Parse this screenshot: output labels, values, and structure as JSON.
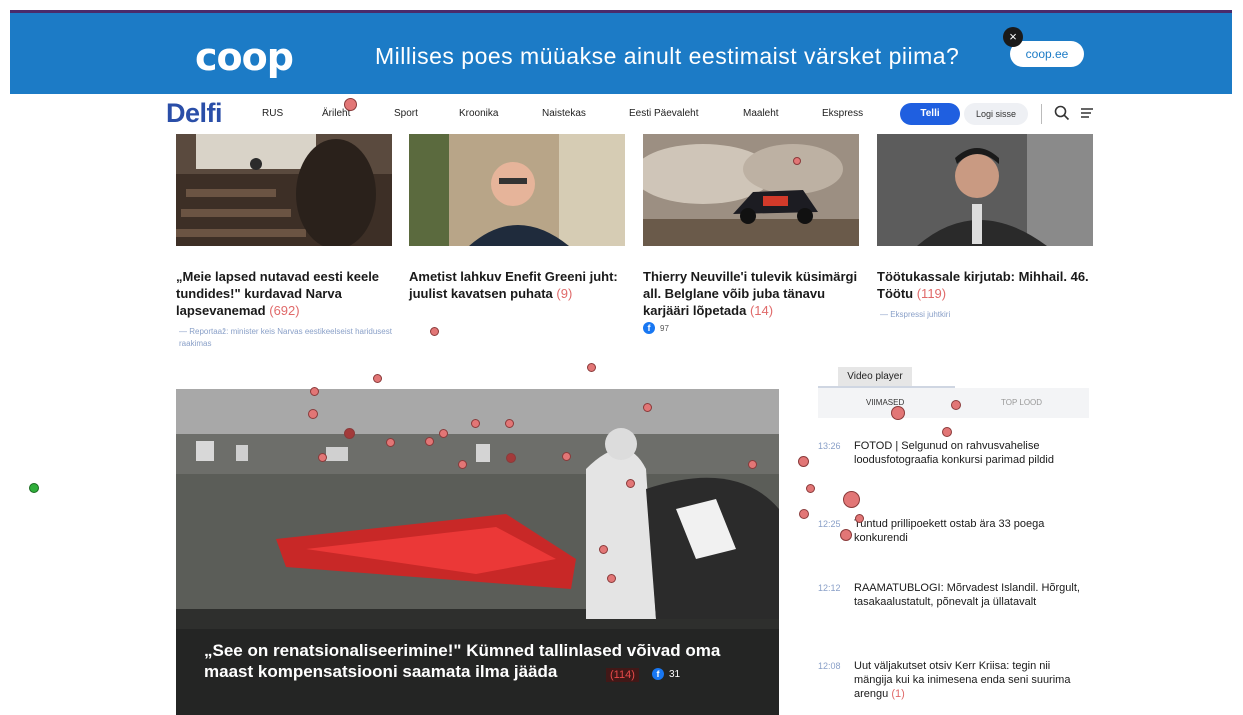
{
  "ad": {
    "logo": "coop",
    "text": "Millises poes müüakse ainult eestimaist värsket piima?",
    "button": "coop.ee",
    "close": "×",
    "colors": {
      "background": "#1c7bc6"
    }
  },
  "nav": {
    "logo": "Delfi",
    "items": [
      "RUS",
      "Ärileht",
      "Sport",
      "Kroonika",
      "Naistekas",
      "Eesti Päevaleht",
      "Maaleht",
      "Ekspress"
    ],
    "subscribe": "Telli",
    "login": "Logi sisse",
    "icons": [
      "search-icon",
      "menu-icon"
    ]
  },
  "cards": [
    {
      "title": "„Meie lapsed nutavad eesti keele tundides!\" kurdavad Narva lapsevanemad",
      "count": "(692)",
      "sub": "— Reportaaž: minister keis Narvas eestikeelseist haridusest raakimas"
    },
    {
      "title": "Ametist lahkuv Enefit Greeni juht: juulist kavatsen puhata",
      "count": "(9)"
    },
    {
      "title": "Thierry Neuville'i tulevik küsimärgi all. Belglane võib juba tänavu karjääri lõpetada",
      "count": "(14)",
      "fb": "97"
    },
    {
      "title": "Töötukassale kirjutab: Mihhail. 46. Töötu",
      "count": "(119)",
      "sub": "— Ekspressi juhtkiri"
    }
  ],
  "hero": {
    "title": "„See on renatsionaliseerimine!\" Kümned tallinlased võivad oma maast kompensatsiooni saamata ilma jääda",
    "count": "(114)",
    "fb": "31"
  },
  "right": {
    "video_tab": "Video player",
    "tab_latest": "VIIMASED",
    "tab_top": "TOP LOOD",
    "news": [
      {
        "time": "13:26",
        "text": "FOTOD | Selgunud on rahvusvahelise loodusfotograafia konkursi parimad pildid"
      },
      {
        "time": "12:25",
        "text": "Tuntud prillipoekett ostab ära 33 poega konkurendi"
      },
      {
        "time": "12:12",
        "text": "RAAMATUBLOGI: Mõrvadest Islandil. Hõrgult, tasakaalustatult, põnevalt ja üllatavalt"
      },
      {
        "time": "12:08",
        "text": "Uut väljakutset otsiv Kerr Kriisa: tegin nii mängija kui ka inimesena enda seni suurima arengu",
        "count": "(1)"
      }
    ]
  }
}
